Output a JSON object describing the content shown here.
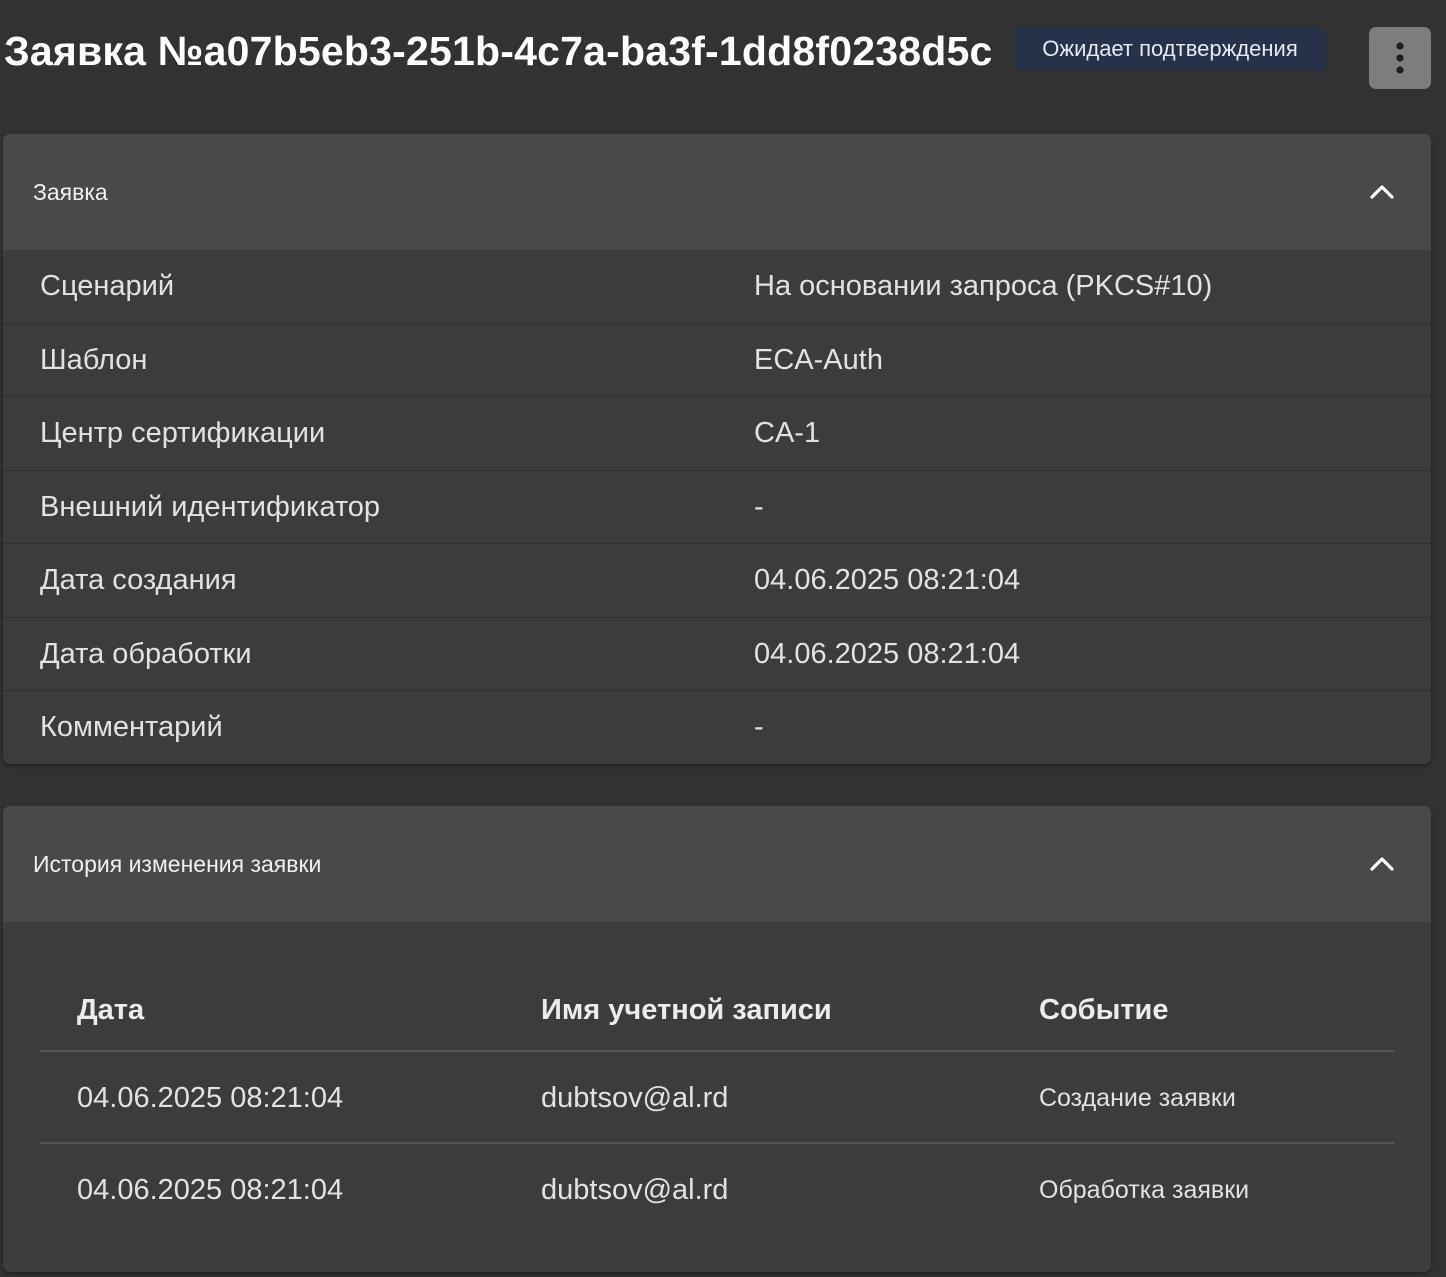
{
  "header": {
    "title": "Заявка №a07b5eb3-251b-4c7a-ba3f-1dd8f0238d5c",
    "status": "Ожидает подтверждения",
    "menu_icon": "more-vert-icon"
  },
  "details_panel": {
    "title": "Заявка",
    "expanded": true,
    "rows": [
      {
        "label": "Сценарий",
        "value": "На основании запроса (PKCS#10)"
      },
      {
        "label": "Шаблон",
        "value": "ECA-Auth"
      },
      {
        "label": "Центр сертификации",
        "value": "CA-1"
      },
      {
        "label": "Внешний идентификатор",
        "value": "-"
      },
      {
        "label": "Дата создания",
        "value": "04.06.2025 08:21:04"
      },
      {
        "label": "Дата обработки",
        "value": "04.06.2025 08:21:04"
      },
      {
        "label": "Комментарий",
        "value": "-"
      }
    ]
  },
  "history_panel": {
    "title": "История изменения заявки",
    "expanded": true,
    "columns": [
      "Дата",
      "Имя учетной записи",
      "Событие"
    ],
    "rows": [
      {
        "date": "04.06.2025 08:21:04",
        "account": "dubtsov@al.rd",
        "event": "Создание заявки"
      },
      {
        "date": "04.06.2025 08:21:04",
        "account": "dubtsov@al.rd",
        "event": "Обработка заявки"
      }
    ]
  },
  "colors": {
    "background": "#323234",
    "panel": "#3c3c3e",
    "panel_header": "#49494b",
    "badge": "#26314a",
    "menu_button": "#7d7d80"
  }
}
